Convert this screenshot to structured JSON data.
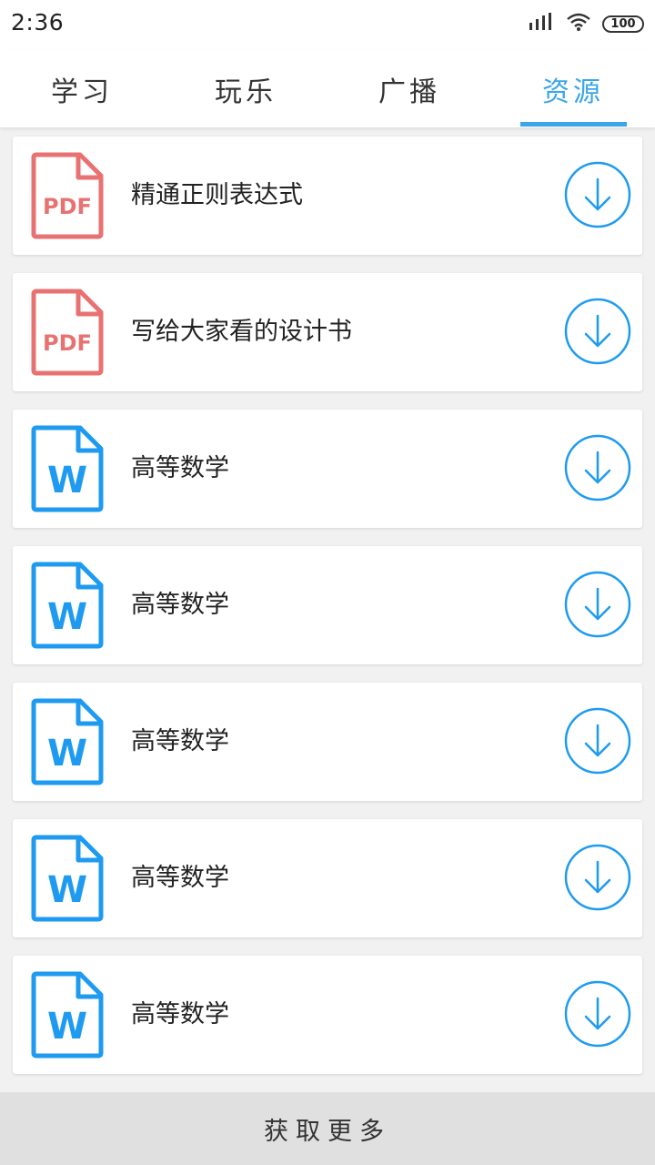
{
  "status_bar": {
    "time": "2:36",
    "battery": "100",
    "signal_icon": "signal-bars-icon",
    "wifi_icon": "wifi-icon"
  },
  "tabs": [
    {
      "label": "学习",
      "active": false
    },
    {
      "label": "玩乐",
      "active": false
    },
    {
      "label": "广播",
      "active": false
    },
    {
      "label": "资源",
      "active": true
    }
  ],
  "accent_color": "#3aa6e8",
  "resources": [
    {
      "name": "精通正则表达式",
      "type": "PDF",
      "icon": "pdf-file-icon",
      "icon_color": "#e87272"
    },
    {
      "name": "写给大家看的设计书",
      "type": "PDF",
      "icon": "pdf-file-icon",
      "icon_color": "#e87272"
    },
    {
      "name": "高等数学",
      "type": "W",
      "icon": "word-file-icon",
      "icon_color": "#1e9bf0"
    },
    {
      "name": "高等数学",
      "type": "W",
      "icon": "word-file-icon",
      "icon_color": "#1e9bf0"
    },
    {
      "name": "高等数学",
      "type": "W",
      "icon": "word-file-icon",
      "icon_color": "#1e9bf0"
    },
    {
      "name": "高等数学",
      "type": "W",
      "icon": "word-file-icon",
      "icon_color": "#1e9bf0"
    },
    {
      "name": "高等数学",
      "type": "W",
      "icon": "word-file-icon",
      "icon_color": "#1e9bf0"
    }
  ],
  "download_icon": "download-circle-icon",
  "footer": {
    "label": "获取更多"
  }
}
